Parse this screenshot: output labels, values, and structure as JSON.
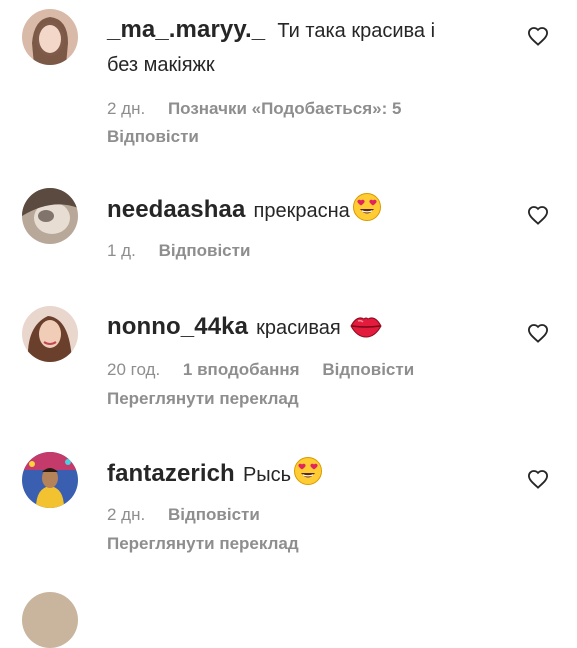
{
  "comments": [
    {
      "username": "_ma_.maryy._",
      "text": "Ти така красива і",
      "text_line2": "без макіяжк",
      "time": "2 дн.",
      "likes": "Позначки «Подобається»: 5",
      "reply": "Відповісти"
    },
    {
      "username": "needaashaa",
      "text": "прекрасна",
      "emoji": "heart-eyes",
      "time": "1 д.",
      "reply": "Відповісти"
    },
    {
      "username": "nonno_44ka",
      "text": "красивая",
      "emoji": "kiss-lips",
      "time": "20 год.",
      "likes": "1 вподобання",
      "reply": "Відповісти",
      "translate": "Переглянути переклад"
    },
    {
      "username": "fantazerich",
      "text": "Рысь",
      "emoji": "heart-eyes",
      "time": "2 дн.",
      "reply": "Відповісти",
      "translate": "Переглянути переклад"
    }
  ],
  "colors": {
    "text": "#262626",
    "meta": "#8e8e8e",
    "background": "#ffffff"
  }
}
